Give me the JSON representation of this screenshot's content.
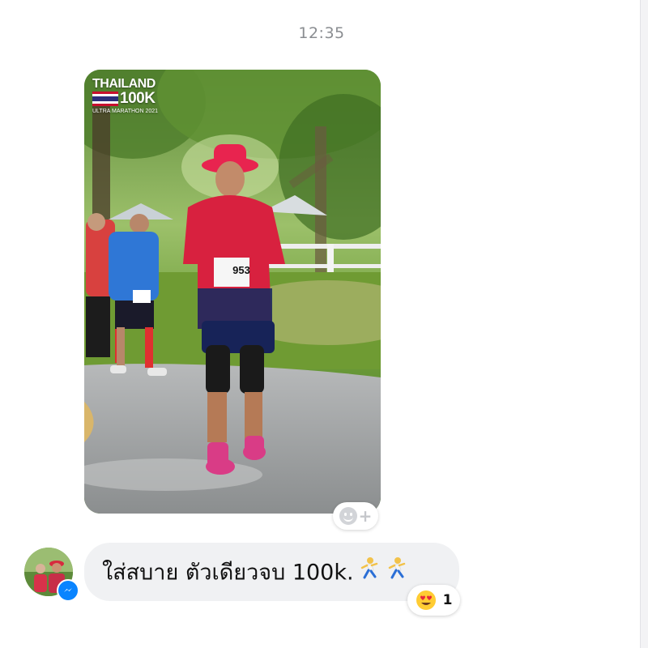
{
  "conversation": {
    "timestamp": "12:35"
  },
  "photo": {
    "logo_line1": "THAILAND",
    "logo_line2": "100K",
    "logo_line3": "ULTRA MARATHON 2021",
    "bib_number": "953"
  },
  "message": {
    "text": "ใส่สบาย ตัวเดียวจบ 100k.",
    "emoji": [
      "running-man-emoji",
      "running-man-emoji"
    ],
    "reaction": {
      "emoji": "heart-eyes-emoji",
      "count": "1"
    }
  },
  "colors": {
    "bubble_bg": "#f0f1f3",
    "messenger_blue": "#0a84ff",
    "timestamp_gray": "#8a8d91"
  }
}
